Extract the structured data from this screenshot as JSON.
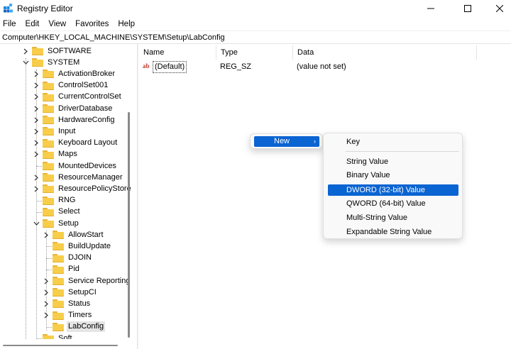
{
  "window": {
    "title": "Registry Editor",
    "controls": {
      "minimize": "minimize-icon",
      "maximize": "maximize-icon",
      "close": "close-icon"
    }
  },
  "menubar": [
    "File",
    "Edit",
    "View",
    "Favorites",
    "Help"
  ],
  "address": "Computer\\HKEY_LOCAL_MACHINE\\SYSTEM\\Setup\\LabConfig",
  "tree": [
    {
      "label": "SOFTWARE",
      "level": 1,
      "chevron": "right"
    },
    {
      "label": "SYSTEM",
      "level": 1,
      "chevron": "down"
    },
    {
      "label": "ActivationBroker",
      "level": 2,
      "chevron": "right"
    },
    {
      "label": "ControlSet001",
      "level": 2,
      "chevron": "right"
    },
    {
      "label": "CurrentControlSet",
      "level": 2,
      "chevron": "right"
    },
    {
      "label": "DriverDatabase",
      "level": 2,
      "chevron": "right"
    },
    {
      "label": "HardwareConfig",
      "level": 2,
      "chevron": "right"
    },
    {
      "label": "Input",
      "level": 2,
      "chevron": "right"
    },
    {
      "label": "Keyboard Layout",
      "level": 2,
      "chevron": "right"
    },
    {
      "label": "Maps",
      "level": 2,
      "chevron": "right"
    },
    {
      "label": "MountedDevices",
      "level": 2,
      "chevron": "none"
    },
    {
      "label": "ResourceManager",
      "level": 2,
      "chevron": "right"
    },
    {
      "label": "ResourcePolicyStore",
      "level": 2,
      "chevron": "right"
    },
    {
      "label": "RNG",
      "level": 2,
      "chevron": "none"
    },
    {
      "label": "Select",
      "level": 2,
      "chevron": "none"
    },
    {
      "label": "Setup",
      "level": 2,
      "chevron": "down"
    },
    {
      "label": "AllowStart",
      "level": 3,
      "chevron": "right"
    },
    {
      "label": "BuildUpdate",
      "level": 3,
      "chevron": "none"
    },
    {
      "label": "DJOIN",
      "level": 3,
      "chevron": "none"
    },
    {
      "label": "Pid",
      "level": 3,
      "chevron": "none"
    },
    {
      "label": "Service Reporting",
      "level": 3,
      "chevron": "right"
    },
    {
      "label": "SetupCI",
      "level": 3,
      "chevron": "right"
    },
    {
      "label": "Status",
      "level": 3,
      "chevron": "right"
    },
    {
      "label": "Timers",
      "level": 3,
      "chevron": "right"
    },
    {
      "label": "LabConfig",
      "level": 3,
      "chevron": "none",
      "selected": true
    },
    {
      "label": "Soft",
      "level": 2,
      "chevron": "none",
      "partial": true
    }
  ],
  "list": {
    "columns": [
      "Name",
      "Type",
      "Data"
    ],
    "rows": [
      {
        "icon": "ab",
        "name": "(Default)",
        "type": "REG_SZ",
        "data": "(value not set)"
      }
    ]
  },
  "context_menu": {
    "item": "New",
    "arrow": "›"
  },
  "submenu": {
    "items": [
      {
        "label": "Key"
      },
      {
        "label": "String Value"
      },
      {
        "label": "Binary Value"
      },
      {
        "label": "DWORD (32-bit) Value",
        "highlighted": true
      },
      {
        "label": "QWORD (64-bit) Value"
      },
      {
        "label": "Multi-String Value"
      },
      {
        "label": "Expandable String Value"
      }
    ]
  },
  "colors": {
    "highlight": "#0a64d2",
    "folder": "#f7cd4a",
    "selected_bg": "#e5e5e5"
  }
}
